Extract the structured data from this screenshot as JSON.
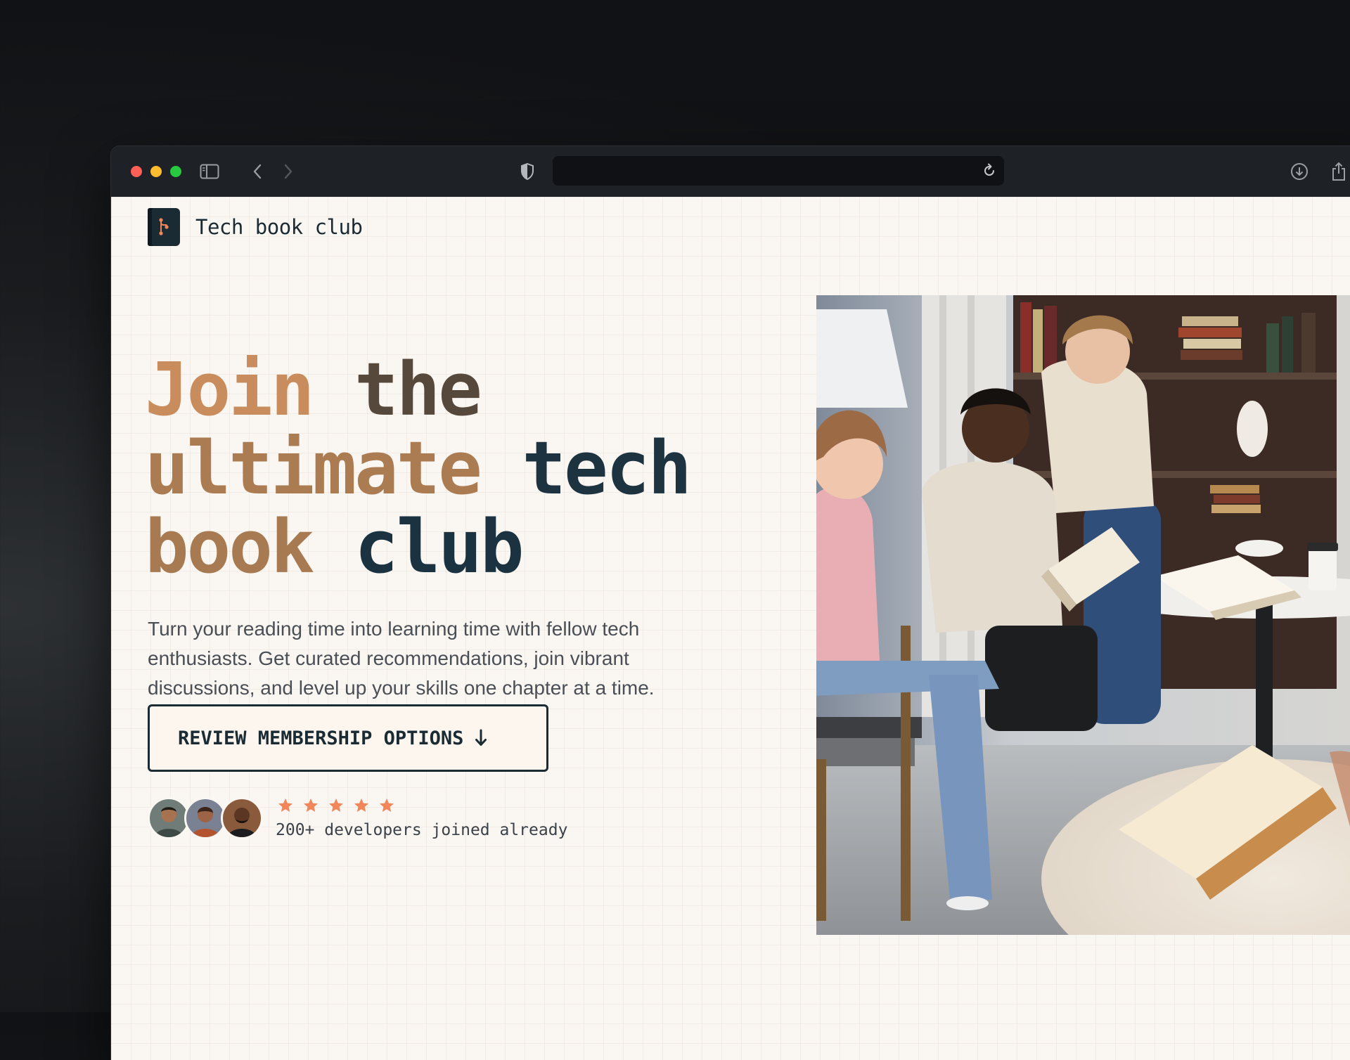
{
  "browser": {
    "url": ""
  },
  "logo": {
    "text": "Tech book club"
  },
  "hero": {
    "words": [
      "Join",
      "the",
      "ultimate",
      "tech",
      "book",
      "club"
    ]
  },
  "lead": "Turn your reading time into learning time with fellow tech enthusiasts. Get curated recommendations, join vibrant discussions, and level up your skills one chapter at a time.",
  "cta": {
    "label": "REVIEW MEMBERSHIP OPTIONS"
  },
  "social_proof": {
    "rating": 5,
    "text": "200+ developers joined already"
  },
  "colors": {
    "accent": "#c98c5c",
    "star": "#f0865a",
    "ink": "#1b2b34",
    "page_bg": "#faf7f3"
  }
}
